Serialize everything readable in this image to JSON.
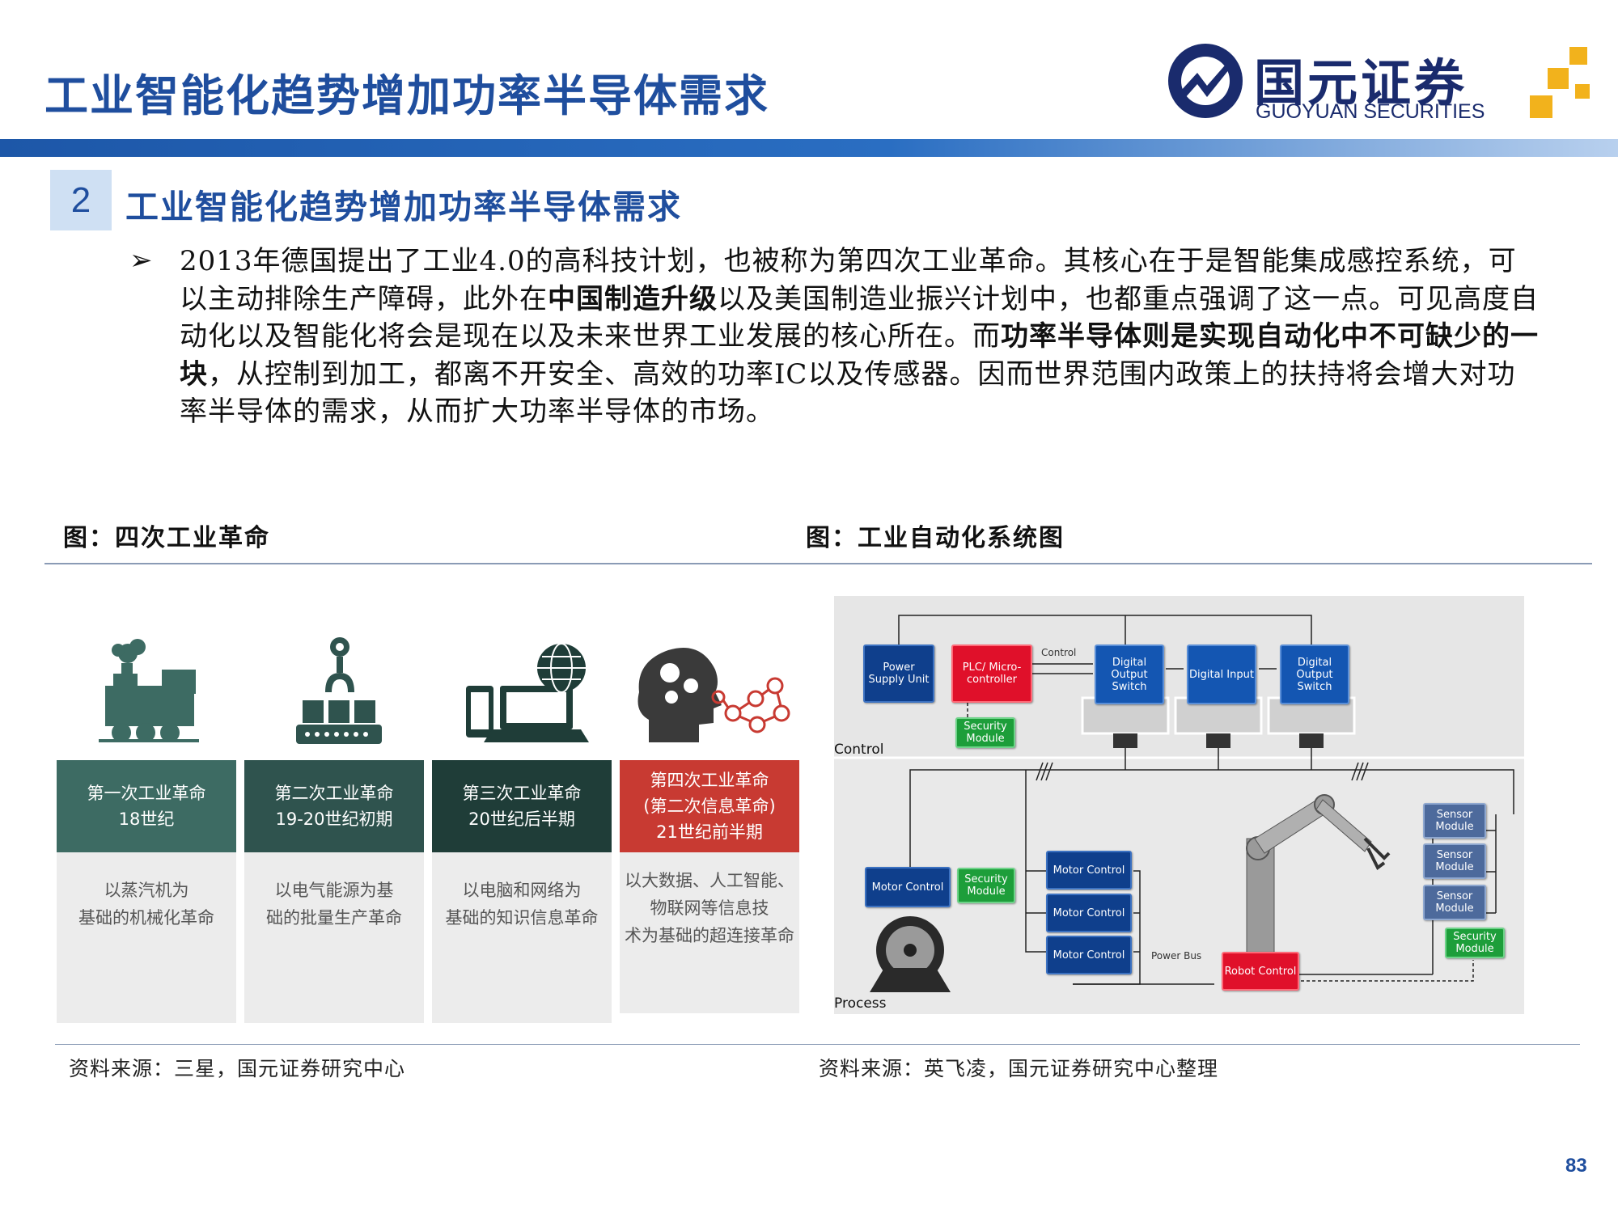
{
  "header": {
    "title": "工业智能化趋势增加功率半导体需求",
    "logo_cn": "国元证券",
    "logo_en": "GUOYUAN SECURITIES"
  },
  "section": {
    "number": "2",
    "title": "工业智能化趋势增加功率半导体需求"
  },
  "body": {
    "bullet": "➢",
    "p1": "2013年德国提出了工业4.0的高科技计划，也被称为第四次工业革命。其核心在于是智能集成感控系统，可以主动排除生产障碍，此外在",
    "p1_bold": "中国制造升级",
    "p2": "以及美国制造业振兴计划中，也都重点强调了这一点。可见高度自动化以及智能化将会是现在以及未来世界工业发展的核心所在。而",
    "p2_bold": "功率半导体则是实现自动化中不可缺少的一块",
    "p3": "，从控制到加工，都离不开安全、高效的功率IC以及传感器。因而世界范围内政策上的扶持将会增大对功率半导体的需求，从而扩大功率半导体的市场。"
  },
  "figures": {
    "left_title": "图：四次工业革命",
    "right_title": "图：工业自动化系统图",
    "left_source": "资料来源：三星，国元证券研究中心",
    "right_source": "资料来源：英飞凌，国元证券研究中心整理"
  },
  "revolutions": [
    {
      "head": [
        "第一次工业革命",
        "18世纪"
      ],
      "body": [
        "以蒸汽机为",
        "基础的机械化革命"
      ],
      "color": "#3d6b63"
    },
    {
      "head": [
        "第二次工业革命",
        "19-20世纪初期"
      ],
      "body": [
        "以电气能源为基",
        "础的批量生产革命"
      ],
      "color": "#2f534e"
    },
    {
      "head": [
        "第三次工业革命",
        "20世纪后半期"
      ],
      "body": [
        "以电脑和网络为",
        "基础的知识信息革命"
      ],
      "color": "#1f3d38"
    },
    {
      "head": [
        "第四次工业革命",
        "(第二次信息革命)",
        "21世纪前半期"
      ],
      "body": [
        "以大数据、人工智能、",
        "物联网等信息技",
        "术为基础的超连接革命"
      ],
      "color": "#c83a32"
    }
  ],
  "diagram": {
    "power_supply": "Power Supply Unit",
    "plc": "PLC/ Micro- controller",
    "control_label": "Control",
    "digital_output_1": "Digital Output Switch",
    "digital_input": "Digital Input",
    "digital_output_2": "Digital Output Switch",
    "security_top": "Security Module",
    "section_control": "Control",
    "section_process": "Process",
    "motor_control_left": "Motor Control",
    "security_left": "Security Module",
    "motor_control_1": "Motor Control",
    "motor_control_2": "Motor Control",
    "motor_control_3": "Motor Control",
    "power_bus": "Power Bus",
    "robot_control": "Robot Control",
    "sensor_1": "Sensor Module",
    "sensor_2": "Sensor Module",
    "sensor_3": "Sensor Module",
    "security_right": "Security Module"
  },
  "page_number": "83",
  "colors": {
    "brand_blue": "#1f4e9e",
    "logo_navy": "#1a2b6d",
    "logo_gold": "#f2b21c"
  }
}
